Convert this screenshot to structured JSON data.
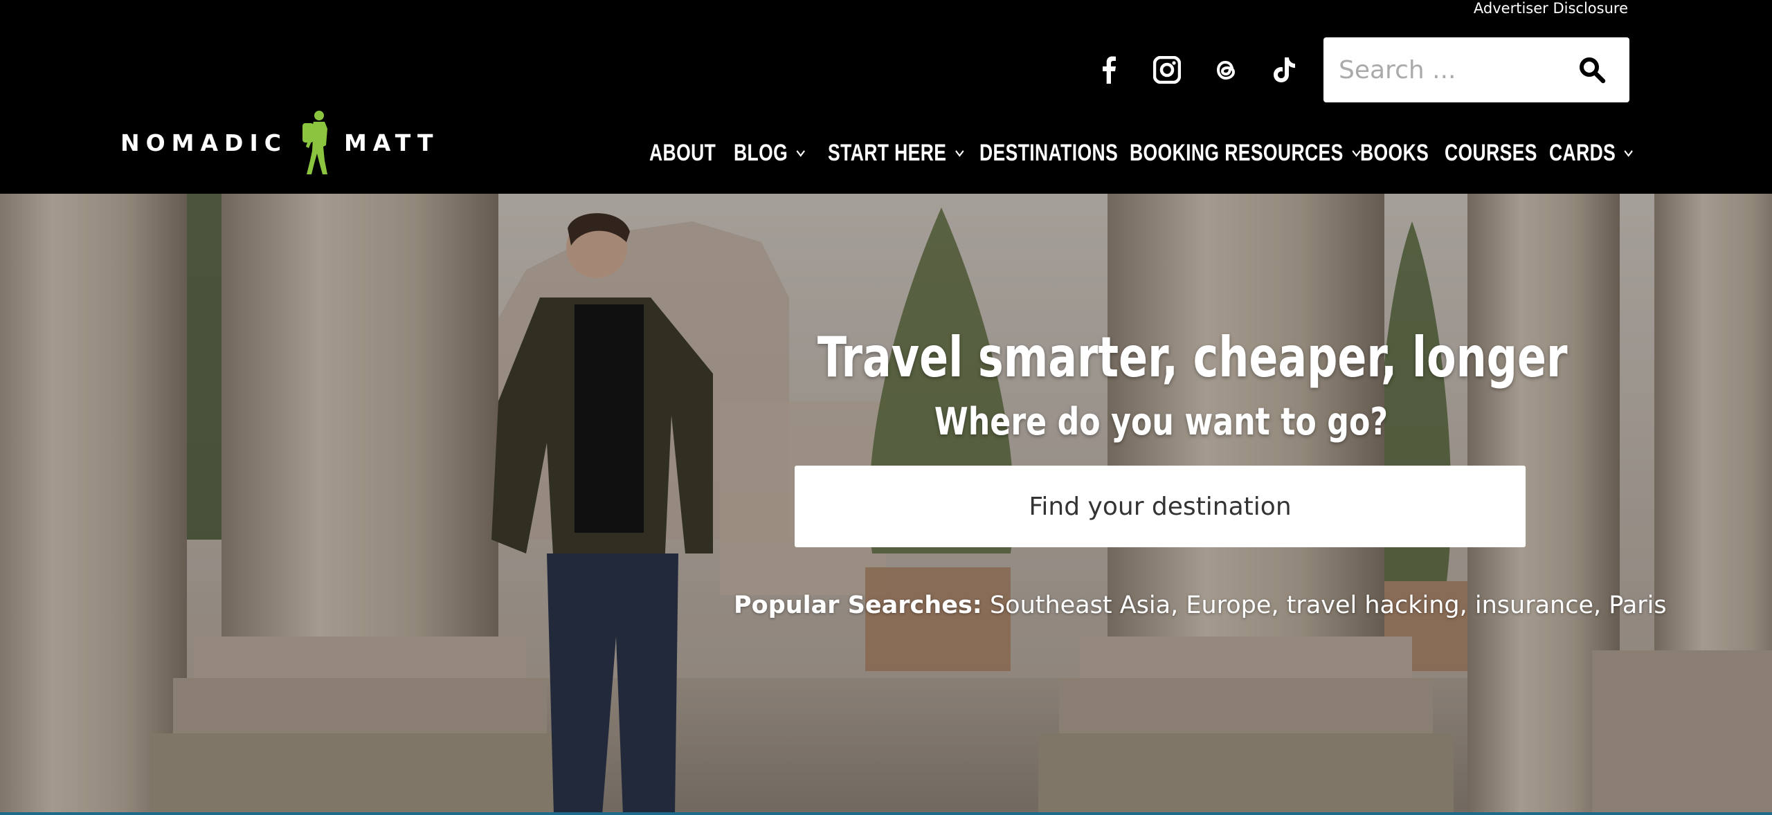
{
  "header": {
    "advertiser_disclosure": "Advertiser Disclosure",
    "logo": {
      "left_word": "NOMADIC",
      "right_word": "MATT",
      "figure_color": "#8bc43f"
    },
    "social": [
      {
        "name": "facebook-icon"
      },
      {
        "name": "instagram-icon"
      },
      {
        "name": "threads-icon"
      },
      {
        "name": "tiktok-icon"
      }
    ],
    "search": {
      "placeholder": "Search ...",
      "value": ""
    },
    "nav": [
      {
        "label": "ABOUT",
        "has_dropdown": false
      },
      {
        "label": "BLOG",
        "has_dropdown": true
      },
      {
        "label": "START HERE",
        "has_dropdown": true
      },
      {
        "label": "DESTINATIONS",
        "has_dropdown": false
      },
      {
        "label": "BOOKING RESOURCES",
        "has_dropdown": true
      },
      {
        "label": "BOOKS",
        "has_dropdown": false
      },
      {
        "label": "COURSES",
        "has_dropdown": false
      },
      {
        "label": "CARDS",
        "has_dropdown": true
      }
    ]
  },
  "hero": {
    "title": "Travel smarter, cheaper, longer",
    "subtitle": "Where do you want to go?",
    "destination_placeholder": "Find your destination",
    "popular_label": "Popular Searches:",
    "popular_items": [
      "Southeast Asia",
      "Europe",
      "travel hacking",
      "insurance",
      "Paris"
    ]
  },
  "colors": {
    "header_bg": "#000000",
    "accent_green": "#8bc43f",
    "bottom_line": "#1d6a8a"
  }
}
